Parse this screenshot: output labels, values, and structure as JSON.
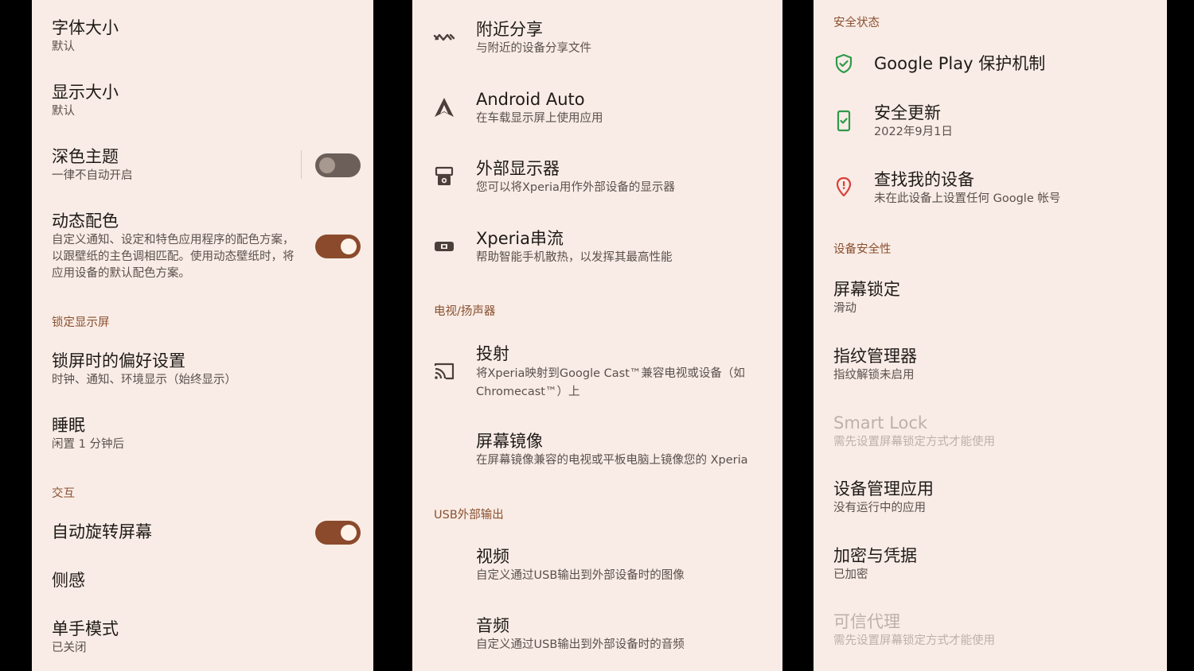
{
  "display_panel": {
    "font_size": {
      "title": "字体大小",
      "summary": "默认"
    },
    "display_size": {
      "title": "显示大小",
      "summary": "默认"
    },
    "dark_theme": {
      "title": "深色主题",
      "summary": "一律不自动开启",
      "enabled": false
    },
    "dynamic_color": {
      "title": "动态配色",
      "summary": "自定义通知、设定和特色应用程序的配色方案，以跟壁纸的主色调相匹配。使用动态壁纸时，将应用设备的默认配色方案。",
      "enabled": true
    },
    "lock_screen_section": "锁定显示屏",
    "lock_screen_prefs": {
      "title": "锁屏时的偏好设置",
      "summary": "时钟、通知、环境显示（始终显示）"
    },
    "sleep": {
      "title": "睡眠",
      "summary": "闲置 1 分钟后"
    },
    "interaction_section": "交互",
    "auto_rotate": {
      "title": "自动旋转屏幕",
      "enabled": true
    },
    "side_sense": {
      "title": "侧感"
    },
    "one_handed": {
      "title": "单手模式",
      "summary": "已关闭"
    }
  },
  "connection_panel": {
    "nearby_share": {
      "title": "附近分享",
      "summary": "与附近的设备分享文件",
      "icon": "nearby-share-icon"
    },
    "android_auto": {
      "title": "Android Auto",
      "summary": "在车载显示屏上使用应用",
      "icon": "android-auto-icon"
    },
    "external_display": {
      "title": "外部显示器",
      "summary": "您可以将Xperia用作外部设备的显示器",
      "icon": "external-display-icon"
    },
    "xperia_stream": {
      "title": "Xperia串流",
      "summary": "帮助智能手机散热，以发挥其最高性能",
      "icon": "gamepad-icon"
    },
    "tv_section": "电视/扬声器",
    "cast": {
      "title": "投射",
      "summary": "将Xperia映射到Google Cast™兼容电视或设备（如Chromecast™）上",
      "icon": "cast-icon"
    },
    "screen_mirroring": {
      "title": "屏幕镜像",
      "summary": "在屏幕镜像兼容的电视或平板电脑上镜像您的 Xperia"
    },
    "usb_section": "USB外部输出",
    "video": {
      "title": "视频",
      "summary": "自定义通过USB输出到外部设备时的图像"
    },
    "audio": {
      "title": "音频",
      "summary": "自定义通过USB输出到外部设备时的音频"
    }
  },
  "security_panel": {
    "status_section": "安全状态",
    "play_protect": {
      "title": "Google Play 保护机制",
      "icon": "shield-check-icon"
    },
    "security_update": {
      "title": "安全更新",
      "summary": "2022年9月1日",
      "icon": "phone-check-icon"
    },
    "find_device": {
      "title": "查找我的设备",
      "summary": "未在此设备上设置任何 Google 帐号",
      "icon": "location-pin-icon"
    },
    "device_security_section": "设备安全性",
    "screen_lock": {
      "title": "屏幕锁定",
      "summary": "滑动"
    },
    "fingerprint": {
      "title": "指纹管理器",
      "summary": "指纹解锁未启用"
    },
    "smart_lock": {
      "title": "Smart Lock",
      "summary": "需先设置屏幕锁定方式才能使用",
      "disabled": true
    },
    "device_admin": {
      "title": "设备管理应用",
      "summary": "没有运行中的应用"
    },
    "encryption": {
      "title": "加密与凭据",
      "summary": "已加密"
    },
    "trust_agents": {
      "title": "可信代理",
      "summary": "需先设置屏幕锁定方式才能使用",
      "disabled": true
    }
  },
  "colors": {
    "panel_bg": "#f9ece6",
    "accent": "#8b4a2c",
    "section": "#8a5030",
    "green": "#2e9a4a",
    "red": "#d9403a"
  }
}
